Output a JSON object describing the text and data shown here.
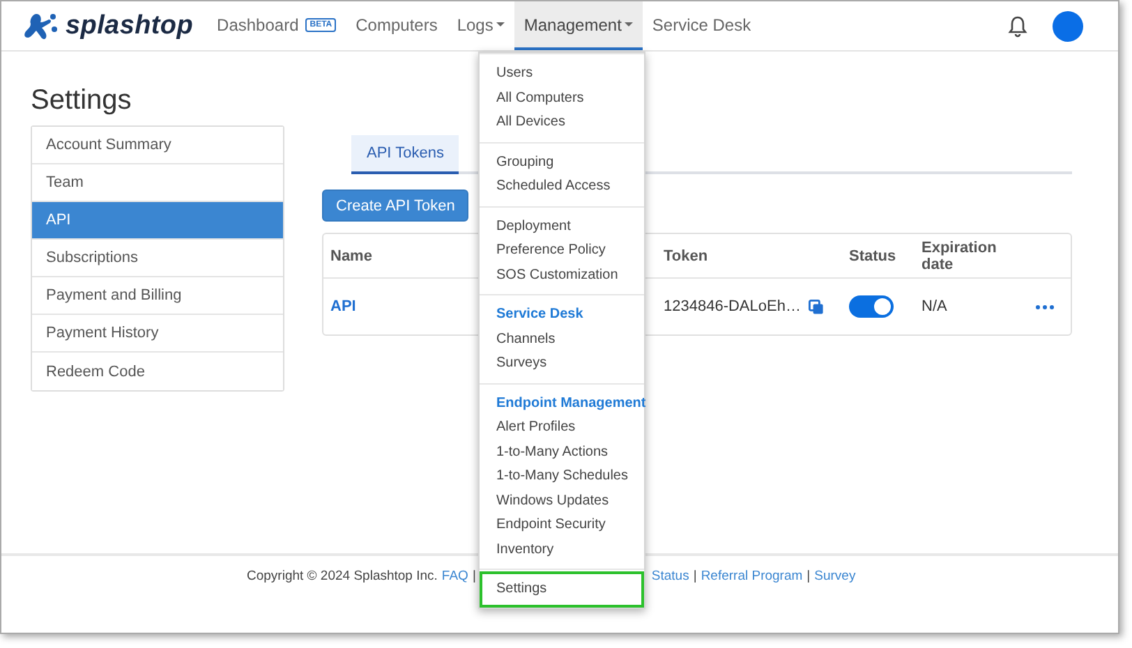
{
  "brand": "splashtop",
  "nav": [
    {
      "label": "Dashboard",
      "badge": "BETA",
      "dropdown": false,
      "selected": false
    },
    {
      "label": "Computers",
      "dropdown": false,
      "selected": false
    },
    {
      "label": "Logs",
      "dropdown": true,
      "selected": false
    },
    {
      "label": "Management",
      "dropdown": true,
      "selected": true
    },
    {
      "label": "Service Desk",
      "dropdown": false,
      "selected": false
    }
  ],
  "page_title": "Settings",
  "sidebar": {
    "items": [
      {
        "label": "Account Summary",
        "selected": false
      },
      {
        "label": "Team",
        "selected": false
      },
      {
        "label": "API",
        "selected": true
      },
      {
        "label": "Subscriptions",
        "selected": false
      },
      {
        "label": "Payment and Billing",
        "selected": false
      },
      {
        "label": "Payment History",
        "selected": false
      },
      {
        "label": "Redeem Code",
        "selected": false
      }
    ]
  },
  "tabs": [
    {
      "label": "API Tokens",
      "selected": true
    }
  ],
  "create_button": "Create API Token",
  "table": {
    "columns": [
      "Name",
      "Token",
      "Status",
      "Expiration date"
    ],
    "rows": [
      {
        "name": "API",
        "token": "1234846-DALoEh…",
        "status_on": true,
        "expiration": "N/A"
      }
    ]
  },
  "dropdown": {
    "sections": [
      {
        "items": [
          {
            "label": "Users",
            "highlighted": false
          },
          {
            "label": "All Computers",
            "highlighted": false
          },
          {
            "label": "All Devices",
            "highlighted": false
          }
        ]
      },
      {
        "items": [
          {
            "label": "Grouping",
            "highlighted": false
          },
          {
            "label": "Scheduled Access",
            "highlighted": false
          }
        ]
      },
      {
        "items": [
          {
            "label": "Deployment",
            "highlighted": false
          },
          {
            "label": "Preference Policy",
            "highlighted": false
          },
          {
            "label": "SOS Customization",
            "highlighted": false
          }
        ]
      },
      {
        "heading": "Service Desk",
        "items": [
          {
            "label": "Channels",
            "highlighted": false
          },
          {
            "label": "Surveys",
            "highlighted": false
          }
        ]
      },
      {
        "heading": "Endpoint Management",
        "items": [
          {
            "label": "Alert Profiles",
            "highlighted": false
          },
          {
            "label": "1-to-Many Actions",
            "highlighted": false
          },
          {
            "label": "1-to-Many Schedules",
            "highlighted": false
          },
          {
            "label": "Windows Updates",
            "highlighted": false
          },
          {
            "label": "Endpoint Security",
            "highlighted": false
          },
          {
            "label": "Inventory",
            "highlighted": false
          }
        ]
      },
      {
        "items": [
          {
            "label": "Settings",
            "highlighted": true
          }
        ]
      }
    ]
  },
  "footer": {
    "copyright": "Copyright © 2024 Splashtop Inc.",
    "left_links": [
      "FAQ"
    ],
    "right_links": [
      "Status",
      "Referral Program",
      "Survey"
    ],
    "separator": "|"
  }
}
